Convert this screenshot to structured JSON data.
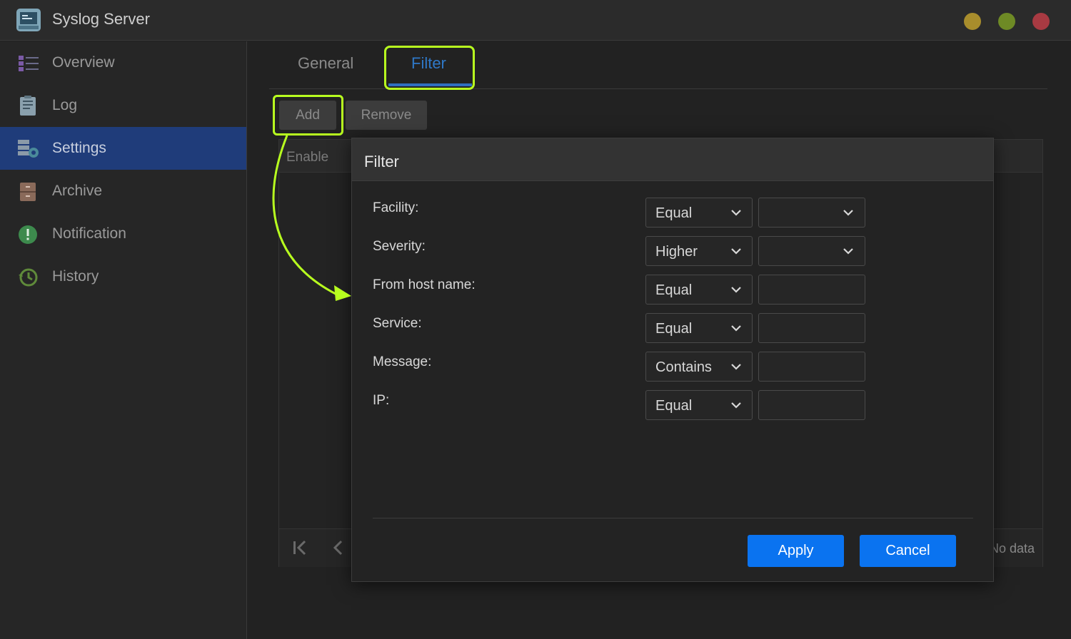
{
  "app": {
    "title": "Syslog Server"
  },
  "sidebar": {
    "items": [
      {
        "label": "Overview",
        "icon": "overview-list-icon"
      },
      {
        "label": "Log",
        "icon": "log-document-icon"
      },
      {
        "label": "Settings",
        "icon": "settings-server-icon",
        "active": true
      },
      {
        "label": "Archive",
        "icon": "archive-cabinet-icon"
      },
      {
        "label": "Notification",
        "icon": "notification-exclamation-icon"
      },
      {
        "label": "History",
        "icon": "history-clock-icon"
      }
    ]
  },
  "tabs": [
    {
      "label": "General"
    },
    {
      "label": "Filter",
      "active": true
    }
  ],
  "toolbar": {
    "add_label": "Add",
    "remove_label": "Remove"
  },
  "grid": {
    "enable_header": "Enable",
    "status": "No data"
  },
  "dialog": {
    "title": "Filter",
    "rows": [
      {
        "label": "Facility:",
        "operator": "Equal",
        "value": ""
      },
      {
        "label": "Severity:",
        "operator": "Higher",
        "value": ""
      },
      {
        "label": "From host name:",
        "operator": "Equal",
        "value": ""
      },
      {
        "label": "Service:",
        "operator": "Equal",
        "value": ""
      },
      {
        "label": "Message:",
        "operator": "Contains",
        "value": ""
      },
      {
        "label": "IP:",
        "operator": "Equal",
        "value": ""
      }
    ],
    "apply_label": "Apply",
    "cancel_label": "Cancel"
  },
  "colors": {
    "accent": "#0a73f0",
    "highlight": "#b8ff1f",
    "sidebar_active": "#1f3c7a",
    "tab_active": "#2f78c7"
  }
}
